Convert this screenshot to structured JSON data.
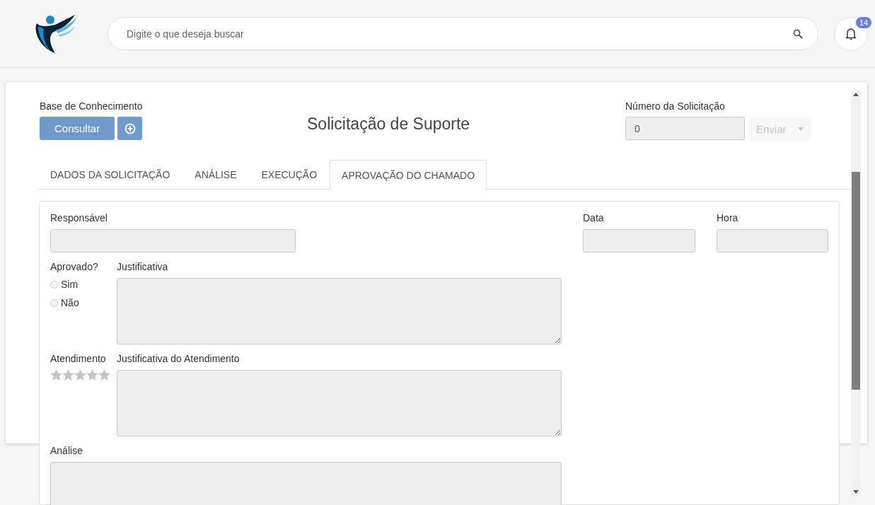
{
  "header": {
    "search": {
      "placeholder": "Digite o que deseja buscar"
    },
    "notifications": {
      "count": "14"
    }
  },
  "form": {
    "knowledge_base": {
      "label": "Base de Conhecimento",
      "button": "Consultar"
    },
    "title": "Solicitação de Suporte",
    "request_number": {
      "label": "Número da Solicitação",
      "value": "0"
    },
    "faded_actions": {
      "button": "Enviar"
    },
    "tabs": [
      {
        "label": "DADOS DA SOLICITAÇÃO",
        "selected": false
      },
      {
        "label": "ANÁLISE",
        "selected": false
      },
      {
        "label": "EXECUÇÃO",
        "selected": false
      },
      {
        "label": "APROVAÇÃO DO CHAMADO",
        "selected": true
      }
    ],
    "responsible": {
      "label": "Responsável"
    },
    "date": {
      "label": "Data"
    },
    "time": {
      "label": "Hora"
    },
    "approved": {
      "label": "Aprovado?",
      "options": [
        {
          "label": "Sim",
          "selected": false
        },
        {
          "label": "Não",
          "selected": false
        }
      ]
    },
    "justification": {
      "label": "Justificativa"
    },
    "service": {
      "label": "Atendimento",
      "stars": 0
    },
    "service_justification": {
      "label": "Justificativa do Atendimento"
    },
    "analysis": {
      "label": "Análise"
    }
  }
}
